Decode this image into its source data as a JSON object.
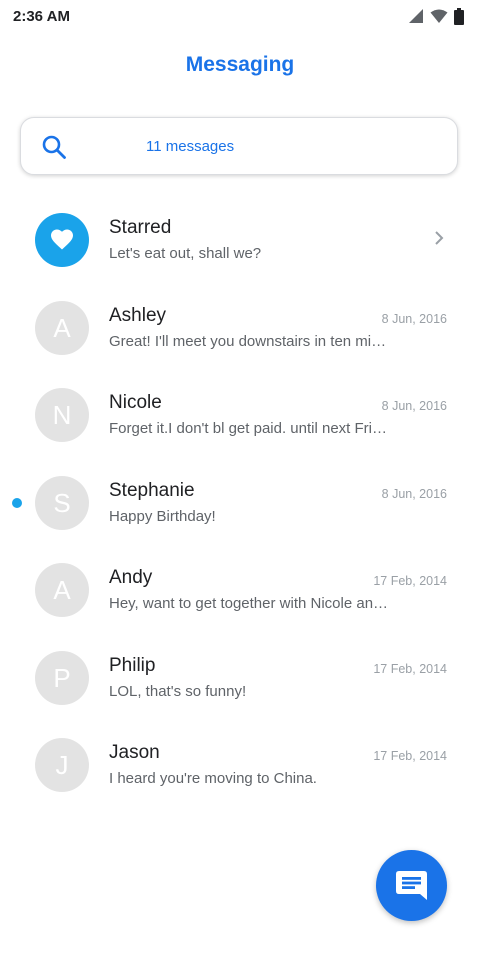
{
  "status_bar": {
    "time": "2:36 AM",
    "icons": [
      "signal-icon",
      "wifi-icon",
      "battery-icon"
    ]
  },
  "header": {
    "title": "Messaging"
  },
  "search": {
    "label": "11 messages",
    "icon": "search-icon"
  },
  "colors": {
    "accent": "#1a73e8",
    "avatar_starred": "#1aa3ea",
    "avatar_default": "#e3e3e3",
    "unread_dot": "#1aa3ea"
  },
  "conversations": [
    {
      "name": "Starred",
      "snippet": "Let's eat out, shall we?",
      "date": "",
      "initial": "",
      "starred": true,
      "unread": false
    },
    {
      "name": "Ashley",
      "snippet": "Great! I'll meet you downstairs in ten minutes.",
      "date": "8 Jun, 2016",
      "initial": "A",
      "starred": false,
      "unread": false
    },
    {
      "name": "Nicole",
      "snippet": "Forget it.I don't bl get paid. until next Friday.",
      "date": "8 Jun, 2016",
      "initial": "N",
      "starred": false,
      "unread": false
    },
    {
      "name": "Stephanie",
      "snippet": "Happy Birthday!",
      "date": "8 Jun, 2016",
      "initial": "S",
      "starred": false,
      "unread": true
    },
    {
      "name": "Andy",
      "snippet": "Hey, want to get together with Nicole and me?",
      "date": "17 Feb, 2014",
      "initial": "A",
      "starred": false,
      "unread": false
    },
    {
      "name": "Philip",
      "snippet": "LOL, that's so funny!",
      "date": "17 Feb, 2014",
      "initial": "P",
      "starred": false,
      "unread": false
    },
    {
      "name": "Jason",
      "snippet": "I heard you're moving to China.",
      "date": "17 Feb, 2014",
      "initial": "J",
      "starred": false,
      "unread": false
    }
  ],
  "fab": {
    "icon": "compose-message-icon"
  }
}
